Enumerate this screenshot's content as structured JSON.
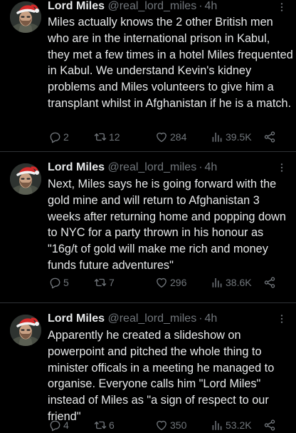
{
  "colors": {
    "background": "#000000",
    "text": "#e7e9ea",
    "secondary": "#71767b",
    "divider": "#2f3336"
  },
  "tweets": [
    {
      "name": "Lord Miles",
      "handle": "@real_lord_miles",
      "dot": "·",
      "time": "4h",
      "text": "Miles actually knows the 2 other British men who are in the international prison in Kabul, they met a few times in a hotel Miles frequented in Kabul. We understand Kevin's kidney problems and Miles volunteers to give him a transplant whilst in Afghanistan if he is a match.",
      "replies": "2",
      "retweets": "12",
      "likes": "284",
      "views": "39.5K"
    },
    {
      "name": "Lord Miles",
      "handle": "@real_lord_miles",
      "dot": "·",
      "time": "4h",
      "text": "Next, Miles says he is going forward with the gold mine and will return to Afghanistan 3 weeks after returning home and popping down to NYC for a party thrown in his honour as \"16g/t of gold will make me rich and money funds future adventures\"",
      "replies": "5",
      "retweets": "7",
      "likes": "296",
      "views": "38.6K"
    },
    {
      "name": "Lord Miles",
      "handle": "@real_lord_miles",
      "dot": "·",
      "time": "4h",
      "text": "Apparently he created a slideshow on powerpoint and pitched the whole thing to minister officals in a meeting he managed to organise. Everyone calls him \"Lord Miles\" instead of Miles as \"a sign of respect to our friend\"",
      "replies": "4",
      "retweets": "6",
      "likes": "350",
      "views": "53.2K"
    }
  ],
  "icons": {
    "avatar": "avatar-santa-hat",
    "more": "more-horizontal-icon",
    "reply": "reply-bubble-icon",
    "retweet": "retweet-icon",
    "like": "heart-icon",
    "views": "views-bar-chart-icon",
    "share": "share-icon"
  }
}
